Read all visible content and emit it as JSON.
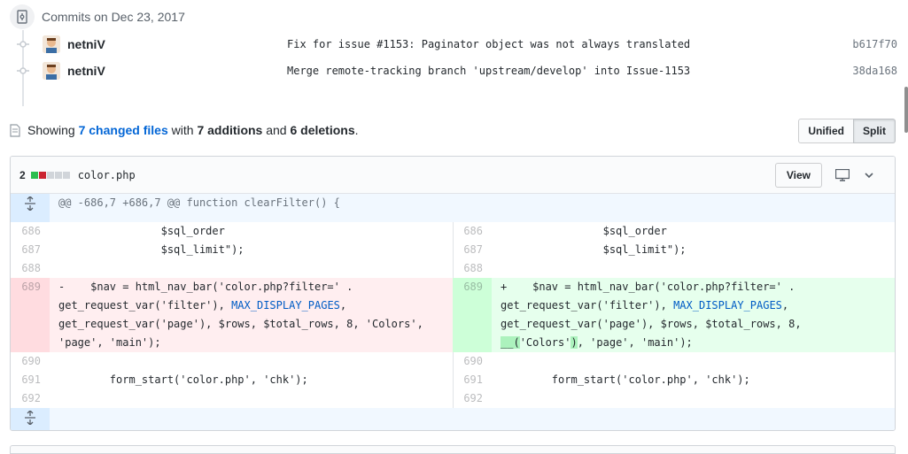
{
  "commits_group": {
    "date_label": "Commits on Dec 23, 2017",
    "commits": [
      {
        "author": "netniV",
        "message": "Fix for issue #1153: Paginator object was not always translated",
        "sha": "b617f70"
      },
      {
        "author": "netniV",
        "message": "Merge remote-tracking branch 'upstream/develop' into Issue-1153",
        "sha": "38da168"
      }
    ]
  },
  "toc": {
    "prefix": "Showing ",
    "changed_files": "7 changed files",
    "with": " with ",
    "additions": "7 additions",
    "and": " and ",
    "deletions": "6 deletions",
    "suffix": "."
  },
  "view_toggle": {
    "unified": "Unified",
    "split": "Split",
    "selected": "Split"
  },
  "file": {
    "diffstat_count": "2",
    "diffstat_colors": [
      "#2cbe4e",
      "#cb2431",
      "#d1d5da",
      "#d1d5da",
      "#d1d5da"
    ],
    "name": "color.php",
    "view_label": "View",
    "hunk_header": "@@ -686,7 +686,7 @@ function clearFilter() {",
    "left": {
      "n686": "686",
      "c686": "                $sql_order",
      "n687": "687",
      "c687": "                $sql_limit\");",
      "n688": "688",
      "n689": "689",
      "c689_a": "-    $nav = html_nav_bar('color.php?filter=' .\nget_request_var('filter'), ",
      "c689_const": "MAX_DISPLAY_PAGES",
      "c689_b": ",\nget_request_var('page'), $rows, $total_rows, 8, 'Colors',\n'page', 'main');",
      "n690": "690",
      "n691": "691",
      "c691": "        form_start('color.php', 'chk');",
      "n692": "692"
    },
    "right": {
      "n686": "686",
      "c686": "                $sql_order",
      "n687": "687",
      "c687": "                $sql_limit\");",
      "n688": "688",
      "n689": "689",
      "c689_a": "+    $nav = html_nav_bar('color.php?filter=' .\nget_request_var('filter'), ",
      "c689_const": "MAX_DISPLAY_PAGES",
      "c689_b": ",\nget_request_var('page'), $rows, $total_rows, 8,\n",
      "c689_hl1": "__(",
      "c689_c": "'Colors'",
      "c689_hl2": ")",
      "c689_d": ", 'page', 'main');",
      "n690": "690",
      "n691": "691",
      "c691": "        form_start('color.php', 'chk');",
      "n692": "692"
    }
  },
  "colors": {
    "link": "#0366d6",
    "deletion": "#ffeef0",
    "addition": "#e6ffed"
  },
  "icons": [
    "commit-icon",
    "commit-dot-icon",
    "avatar",
    "file-diff-icon",
    "desktop-icon",
    "chevron-down-icon",
    "expand-icon"
  ]
}
